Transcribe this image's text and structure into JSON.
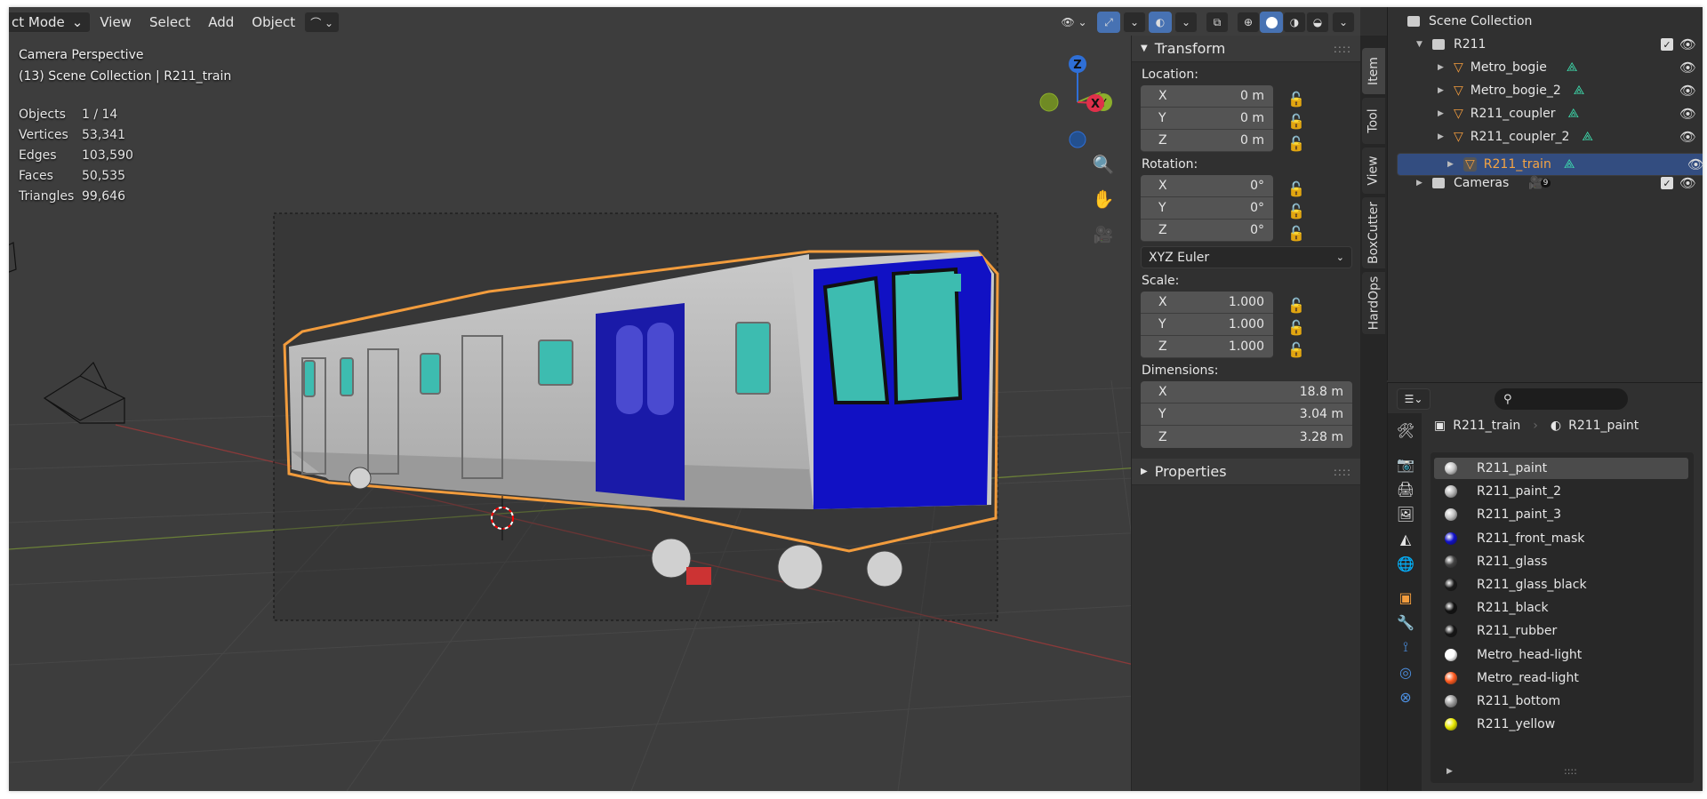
{
  "header": {
    "mode": "ct Mode",
    "menus": [
      "View",
      "Select",
      "Add",
      "Object"
    ]
  },
  "overlay": {
    "view_name": "Camera Perspective",
    "collection_line": "(13) Scene Collection | R211_train"
  },
  "stats": [
    {
      "k": "Objects",
      "v": "1 / 14"
    },
    {
      "k": "Vertices",
      "v": "53,341"
    },
    {
      "k": "Edges",
      "v": "103,590"
    },
    {
      "k": "Faces",
      "v": "50,535"
    },
    {
      "k": "Triangles",
      "v": "99,646"
    }
  ],
  "gizmo": {
    "z": "Z",
    "x": "X",
    "y": "Y"
  },
  "transform": {
    "title": "Transform",
    "location_label": "Location:",
    "rotation_label": "Rotation:",
    "scale_label": "Scale:",
    "dimensions_label": "Dimensions:",
    "location": [
      {
        "ax": "X",
        "v": "0 m"
      },
      {
        "ax": "Y",
        "v": "0 m"
      },
      {
        "ax": "Z",
        "v": "0 m"
      }
    ],
    "rotation": [
      {
        "ax": "X",
        "v": "0°"
      },
      {
        "ax": "Y",
        "v": "0°"
      },
      {
        "ax": "Z",
        "v": "0°"
      }
    ],
    "rotation_mode": "XYZ Euler",
    "scale": [
      {
        "ax": "X",
        "v": "1.000"
      },
      {
        "ax": "Y",
        "v": "1.000"
      },
      {
        "ax": "Z",
        "v": "1.000"
      }
    ],
    "dimensions": [
      {
        "ax": "X",
        "v": "18.8 m"
      },
      {
        "ax": "Y",
        "v": "3.04 m"
      },
      {
        "ax": "Z",
        "v": "3.28 m"
      }
    ],
    "properties_title": "Properties"
  },
  "side_tabs": [
    "Item",
    "Tool",
    "View",
    "BoxCutter",
    "HardOps"
  ],
  "outliner": {
    "root": "Scene Collection",
    "collection": "R211",
    "objects": [
      "Metro_bogie",
      "Metro_bogie_2",
      "R211_coupler",
      "R211_coupler_2",
      "R211_train"
    ],
    "cameras": "Cameras",
    "cameras_count": "9"
  },
  "properties": {
    "object": "R211_train",
    "material": "R211_paint",
    "slots": [
      {
        "name": "R211_paint",
        "color": "#c8c8c8"
      },
      {
        "name": "R211_paint_2",
        "color": "#b5b5b5"
      },
      {
        "name": "R211_paint_3",
        "color": "#c0c0c0"
      },
      {
        "name": "R211_front_mask",
        "color": "#1010c8"
      },
      {
        "name": "R211_glass",
        "color": "#444444"
      },
      {
        "name": "R211_glass_black",
        "color": "#1a1a1a"
      },
      {
        "name": "R211_black",
        "color": "#111111"
      },
      {
        "name": "R211_rubber",
        "color": "#161616"
      },
      {
        "name": "Metro_head-light",
        "color": "#ffffff"
      },
      {
        "name": "Metro_read-light",
        "color": "#ff5a1e"
      },
      {
        "name": "R211_bottom",
        "color": "#9a9a9a"
      },
      {
        "name": "R211_yellow",
        "color": "#e8e800"
      }
    ],
    "accent": "#4772b3",
    "selection": "#f29c3d"
  }
}
